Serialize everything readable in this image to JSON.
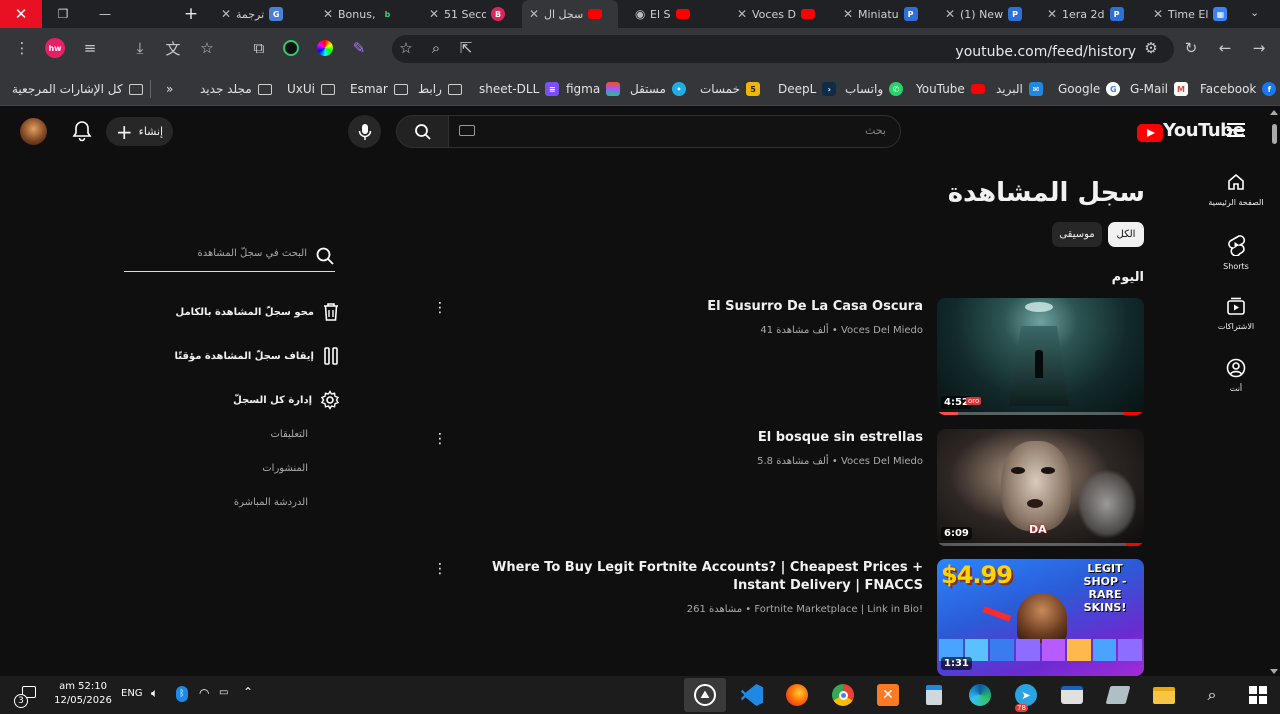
{
  "window": {
    "close": "✕",
    "restore": "❐",
    "minimize": "—",
    "new_tab": "+"
  },
  "tabs": [
    {
      "label": "ترجمة",
      "close": "✕",
      "favicon": "translate-icon"
    },
    {
      "label": "Bonus,",
      "close": "✕",
      "favicon": "b-icon"
    },
    {
      "label": "51 Seco",
      "close": "✕",
      "favicon": "bitcoin-icon"
    },
    {
      "label": "سجل ال",
      "close": "✕",
      "favicon": "youtube-icon"
    },
    {
      "label": "El S",
      "close": "✕",
      "favicon": "youtube-icon"
    },
    {
      "label": "Voces D",
      "close": "✕",
      "favicon": "youtube-icon"
    },
    {
      "label": "Miniatu",
      "close": "✕",
      "favicon": "p-icon"
    },
    {
      "label": "(1) New",
      "close": "✕",
      "favicon": "p-icon"
    },
    {
      "label": "1era 2d",
      "close": "✕",
      "favicon": "p-icon"
    },
    {
      "label": "Time El",
      "close": "✕",
      "favicon": "app-icon"
    }
  ],
  "address": {
    "url": "youtube.com/feed/history"
  },
  "bookmarks": [
    {
      "label": "كل الإشارات المرجعية"
    },
    {
      "label": "»"
    },
    {
      "label": "مجلد جديد"
    },
    {
      "label": "UxUi"
    },
    {
      "label": "Esmar"
    },
    {
      "label": "رابط"
    },
    {
      "label": "sheet-DLL"
    },
    {
      "label": "figma"
    },
    {
      "label": "مستقل"
    },
    {
      "label": "خمسات"
    },
    {
      "label": "DeepL"
    },
    {
      "label": "واتساب"
    },
    {
      "label": "YouTube"
    },
    {
      "label": "البريد"
    },
    {
      "label": "Google"
    },
    {
      "label": "G-Mail"
    },
    {
      "label": "Facebook"
    }
  ],
  "youtube": {
    "logo": "YouTube",
    "search_placeholder": "بحث",
    "create_label": "إنشاء",
    "sidebar": [
      {
        "label": "الصفحة الرئيسية",
        "icon": "home-icon"
      },
      {
        "label": "Shorts",
        "icon": "shorts-icon"
      },
      {
        "label": "الاشتراكات",
        "icon": "subscriptions-icon"
      },
      {
        "label": "أنت",
        "icon": "you-icon"
      }
    ],
    "page_title": "سجل المشاهدة",
    "chips": [
      {
        "label": "الكل"
      },
      {
        "label": "موسيقى"
      }
    ],
    "section": "اليوم",
    "videos": [
      {
        "title": "El Susurro De La Casa Oscura",
        "meta": "41 ألف مشاهدة • Voces Del Miedo",
        "duration": "4:52",
        "progress": 0.1
      },
      {
        "title": "El bosque sin estrellas",
        "meta": "5.8 ألف مشاهدة • Voces Del Miedo",
        "duration": "6:09",
        "progress": 0
      },
      {
        "title": "Where To Buy Legit Fortnite Accounts? | Cheapest Prices + Instant Delivery | FNACCS",
        "meta": "261 مشاهدة • Fortnite Marketplace | Link in Bio!",
        "duration": "1:31",
        "progress": 0,
        "thumb_left": "$4.99",
        "thumb_right": "LEGIT SHOP - RARE SKINS!"
      }
    ],
    "history_search_placeholder": "البحث في سجلّ المشاهدة",
    "actions": [
      {
        "label": "محو سجلّ المشاهدة بالكامل"
      },
      {
        "label": "إيقاف سجلّ المشاهدة مؤقتًا"
      },
      {
        "label": "إدارة كل السجلّ"
      }
    ],
    "sub_links": [
      {
        "label": "التعليقات"
      },
      {
        "label": "المنشورات"
      },
      {
        "label": "الدردشة المباشرة"
      }
    ]
  },
  "taskbar": {
    "time": "am 52:10",
    "date": "12/05/2026",
    "lang": "ENG",
    "notif_count": "3",
    "telegram_badge": "78"
  }
}
